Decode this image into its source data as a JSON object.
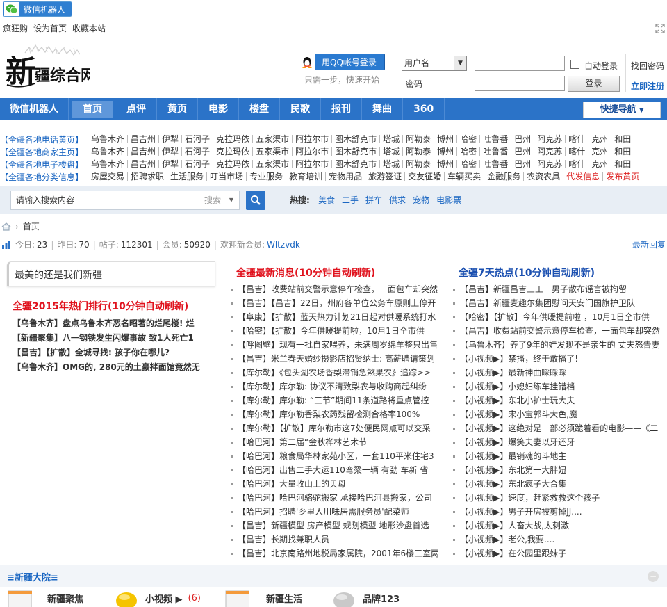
{
  "top": {
    "wechat_label": "微信机器人",
    "links": [
      "疯狂购",
      "设为首页",
      "收藏本站"
    ]
  },
  "login": {
    "qq_label": "用QQ帐号登录",
    "qq_tip": "只需一步，快速开始",
    "user_select": "用户名",
    "password_label": "密码",
    "auto_login": "自动登录",
    "login_button": "登录",
    "find_password": "找回密码",
    "register": "立即注册"
  },
  "nav": {
    "items": [
      "微信机器人",
      "首页",
      "点评",
      "黄页",
      "电影",
      "楼盘",
      "民歌",
      "报刊",
      "舞曲",
      "360"
    ],
    "quick": "快捷导航"
  },
  "regions": [
    {
      "label": "【全疆各地电话黄页】",
      "items": [
        "乌鲁木齐",
        "昌吉州",
        "伊犁",
        "石河子",
        "克拉玛依",
        "五家渠市",
        "阿拉尔市",
        "图木舒克市",
        "塔城",
        "阿勒泰",
        "博州",
        "哈密",
        "吐鲁番",
        "巴州",
        "阿克苏",
        "喀什",
        "克州",
        "和田"
      ]
    },
    {
      "label": "【全疆各地商家主页】",
      "items": [
        "乌鲁木齐",
        "昌吉州",
        "伊犁",
        "石河子",
        "克拉玛依",
        "五家渠市",
        "阿拉尔市",
        "图木舒克市",
        "塔城",
        "阿勒泰",
        "博州",
        "哈密",
        "吐鲁番",
        "巴州",
        "阿克苏",
        "喀什",
        "克州",
        "和田"
      ]
    },
    {
      "label": "【全疆各地电子楼盘】",
      "items": [
        "乌鲁木齐",
        "昌吉州",
        "伊犁",
        "石河子",
        "克拉玛依",
        "五家渠市",
        "阿拉尔市",
        "图木舒克市",
        "塔城",
        "阿勒泰",
        "博州",
        "哈密",
        "吐鲁番",
        "巴州",
        "阿克苏",
        "喀什",
        "克州",
        "和田"
      ]
    },
    {
      "label": "【全疆各地分类信息】",
      "items": [
        "房屋交易",
        "招聘求职",
        "生活服务",
        "叮当市场",
        "专业服务",
        "教育培训",
        "宠物用品",
        "旅游签证",
        "交友征婚",
        "车辆买卖",
        "金融服务",
        "农资农具"
      ],
      "red_items": [
        "代发信息",
        "发布黄页"
      ]
    }
  ],
  "search": {
    "placeholder": "请输入搜索内容",
    "type": "搜索",
    "hot_label": "热搜:",
    "hot_links": [
      "美食",
      "二手",
      "拼车",
      "供求",
      "宠物",
      "电影票"
    ]
  },
  "breadcrumb": {
    "home": "首页"
  },
  "stats": {
    "today_label": "今日:",
    "today": "23",
    "yesterday_label": "昨日:",
    "yesterday": "70",
    "posts_label": "帖子:",
    "posts": "112301",
    "members_label": "会员:",
    "members": "50920",
    "welcome": "欢迎新会员:",
    "new_member": "Wltzvdk",
    "latest_reply": "最新回复"
  },
  "left": {
    "tab_title": "最美的还是我们新疆",
    "hot_title": "全疆2015年热门排行(10分钟自动刷新)",
    "hot_items": [
      "【乌鲁木齐】盘点乌鲁木齐恶名昭著的烂尾楼! 烂",
      "【新疆聚集】八一钢铁发生闪爆事故 致1人死亡1",
      "【昌吉】【扩散】全城寻找: 孩子你在哪儿?",
      "【乌鲁木齐】OMG的, 280元的土豪拌面馆竟然无"
    ]
  },
  "middle": {
    "title": "全疆最新消息(10分钟自动刷新)",
    "items": [
      "【昌吉】收费站前交警示意停车检查，一面包车却突然",
      "【昌吉】【昌吉】22日，州府各单位公务车原则上停开",
      "【阜康】【扩散】蓝天热力计划21日起对供暖系统打水",
      "【哈密】【扩散】今年供暖提前啦，10月1日全市供",
      "【呼图壁】现有一批自家喂养，未满周岁绵羊整只出售",
      "【昌吉】米兰春天婚纱摄影店招贤纳士: 高薪聘请策划",
      "【库尔勒】《包头湖农场香梨滞销急煞果农》追踪>>",
      "【库尔勒】库尔勒: 协议不清致梨农与收购商起纠纷",
      "【库尔勒】库尔勒: “三节”期间11条道路将重点管控",
      "【库尔勒】库尔勒香梨农药残留检测合格率100%",
      "【库尔勒】【扩散】库尔勒市这7处便民网点可以交采",
      "【哈巴河】第二届“金秋桦林艺术节",
      "【哈巴河】粮食局华林家苑小区，一套110平米住宅3",
      "【哈巴河】出售二手大运110弯梁一辆 有劲 车新 省",
      "【哈巴河】大量收山上的贝母",
      "【哈巴河】哈巴河骆驼搬家 承接哈巴河县搬家，公司",
      "【哈巴河】招聘'乡里人川味居需服务员'配菜师",
      "【昌吉】新疆模型 房产模型 规划模型 地形沙盘首选",
      "【昌吉】长期找兼职人员",
      "【昌吉】北京南路州地税局家属院，2001年6楼三室两"
    ]
  },
  "right": {
    "title": "全疆7天热点(10分钟自动刷新)",
    "items": [
      "【昌吉】新疆昌吉三工一男子散布谣言被拘留",
      "【昌吉】新疆麦趣尔集团慰问天安门国旗护卫队",
      "【哈密】【扩散】今年供暖提前啦 ，10月1日全市供",
      "【昌吉】收费站前交警示意停车检查，一面包车却突然",
      "【乌鲁木齐】养了9年的娃发现不是亲生的 丈夫怒告妻",
      "【小视频▶】禁播，终于敢播了!",
      "【小视频▶】最新神曲睬睬睬",
      "【小视频▶】小媳妇练车挂错档",
      "【小视频▶】东北小护士玩大夫",
      "【小视频▶】宋小宝郭斗大色,魔",
      "【小视频▶】这绝对是一部必须跪着看的电影——《二",
      "【小视频▶】爆笑夫妻以牙还牙",
      "【小视频▶】最销魂的斗地主",
      "【小视频▶】东北第一大胖妞",
      "【小视频▶】东北疯子大合集",
      "【小视频▶】速度，赶紧救救这个孩子",
      "【小视频▶】男子开房被剪掉JJ....",
      "【小视频▶】人畜大战,太刺激",
      "【小视频▶】老公,我要....",
      "【小视频▶】在公园里跟妹子"
    ]
  },
  "forum": {
    "title": "≡新疆大院≡",
    "items": [
      {
        "name": "新疆聚焦",
        "count": ""
      },
      {
        "name": "小视频 ▶",
        "count": "(6)"
      },
      {
        "name": "新疆生活",
        "count": ""
      },
      {
        "name": "品牌123",
        "count": ""
      }
    ]
  },
  "colors": {
    "brand_blue": "#2b73c8",
    "hot_red": "#e0131e"
  }
}
